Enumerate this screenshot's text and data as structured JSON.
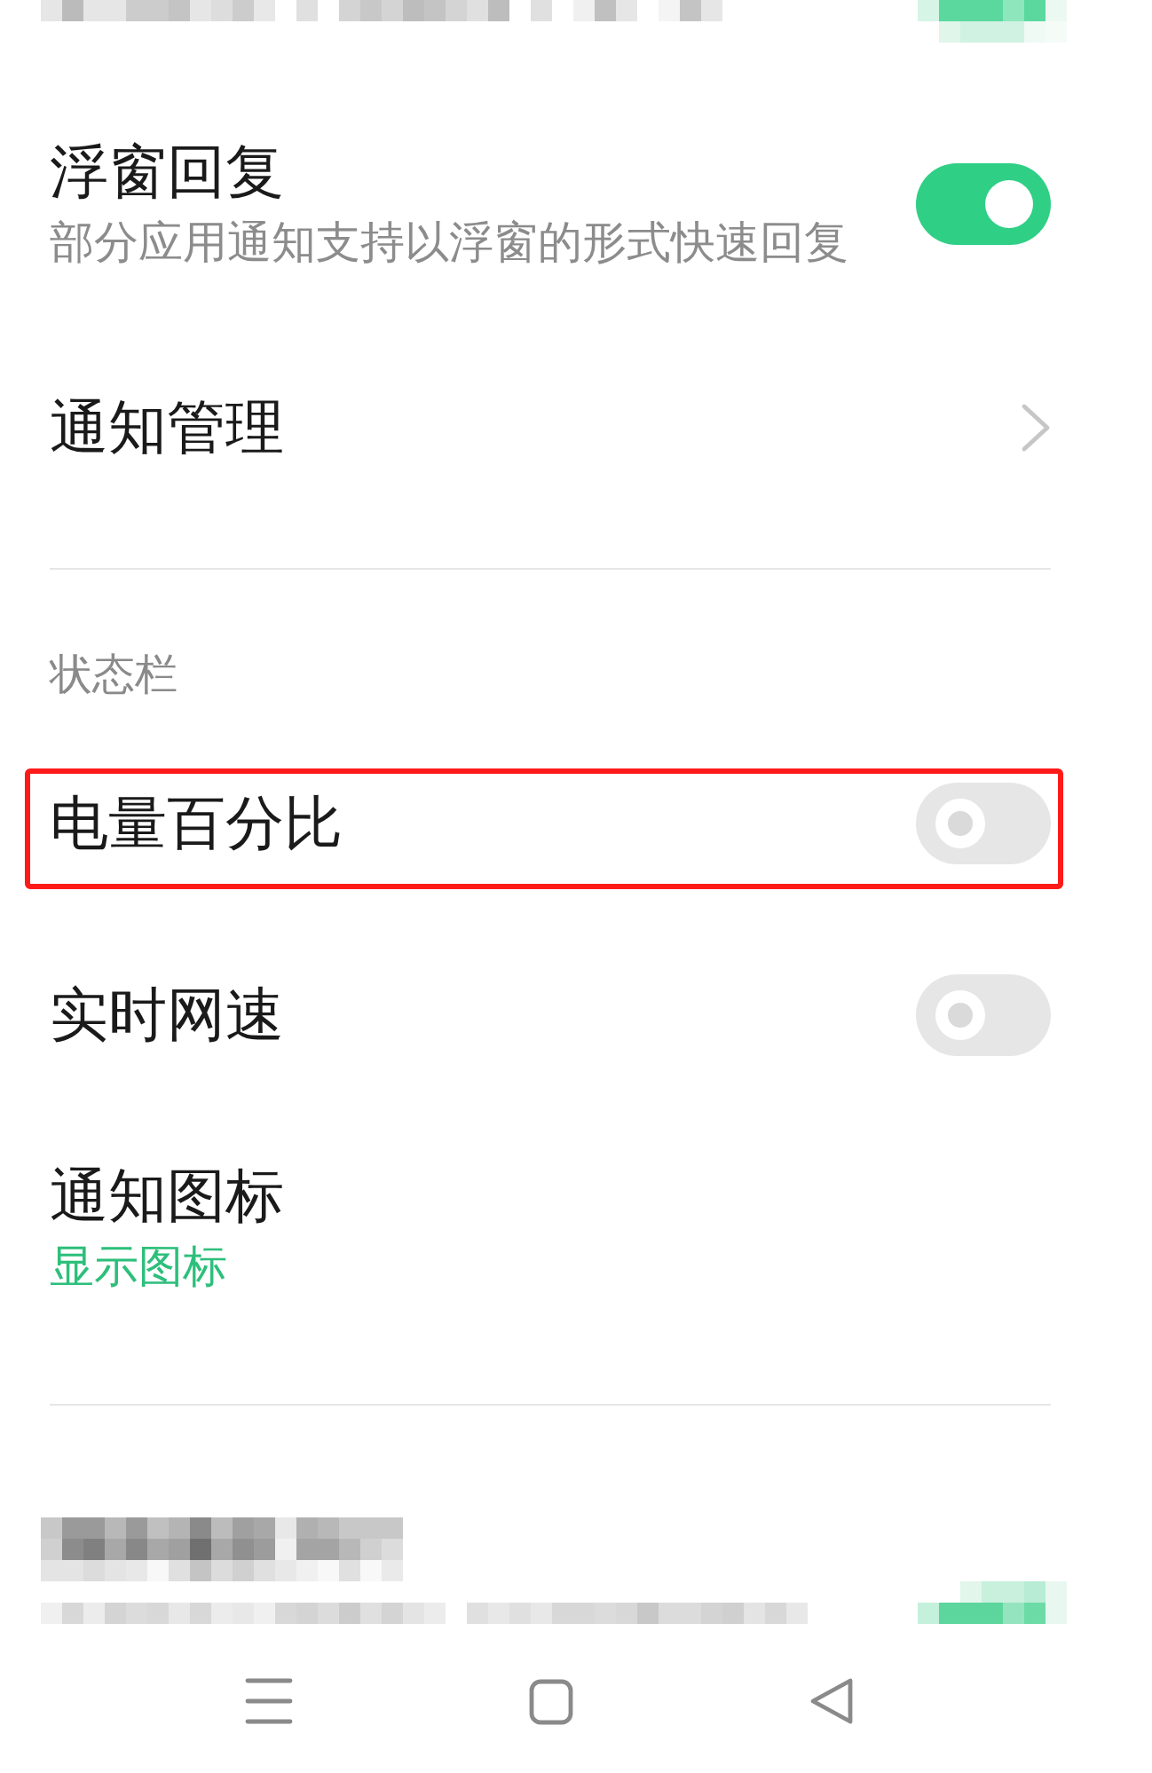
{
  "sections": [
    {
      "items": [
        {
          "kind": "switch",
          "title": "浮窗回复",
          "subtitle": "部分应用通知支持以浮窗的形式快速回复",
          "on": true,
          "highlighted": false
        },
        {
          "kind": "link",
          "title": "通知管理",
          "highlighted": false
        }
      ]
    },
    {
      "header": "状态栏",
      "items": [
        {
          "kind": "switch",
          "title": "电量百分比",
          "on": false,
          "highlighted": true
        },
        {
          "kind": "switch",
          "title": "实时网速",
          "on": false,
          "highlighted": false
        },
        {
          "kind": "value",
          "title": "通知图标",
          "value": "显示图标",
          "highlighted": false
        }
      ]
    }
  ]
}
